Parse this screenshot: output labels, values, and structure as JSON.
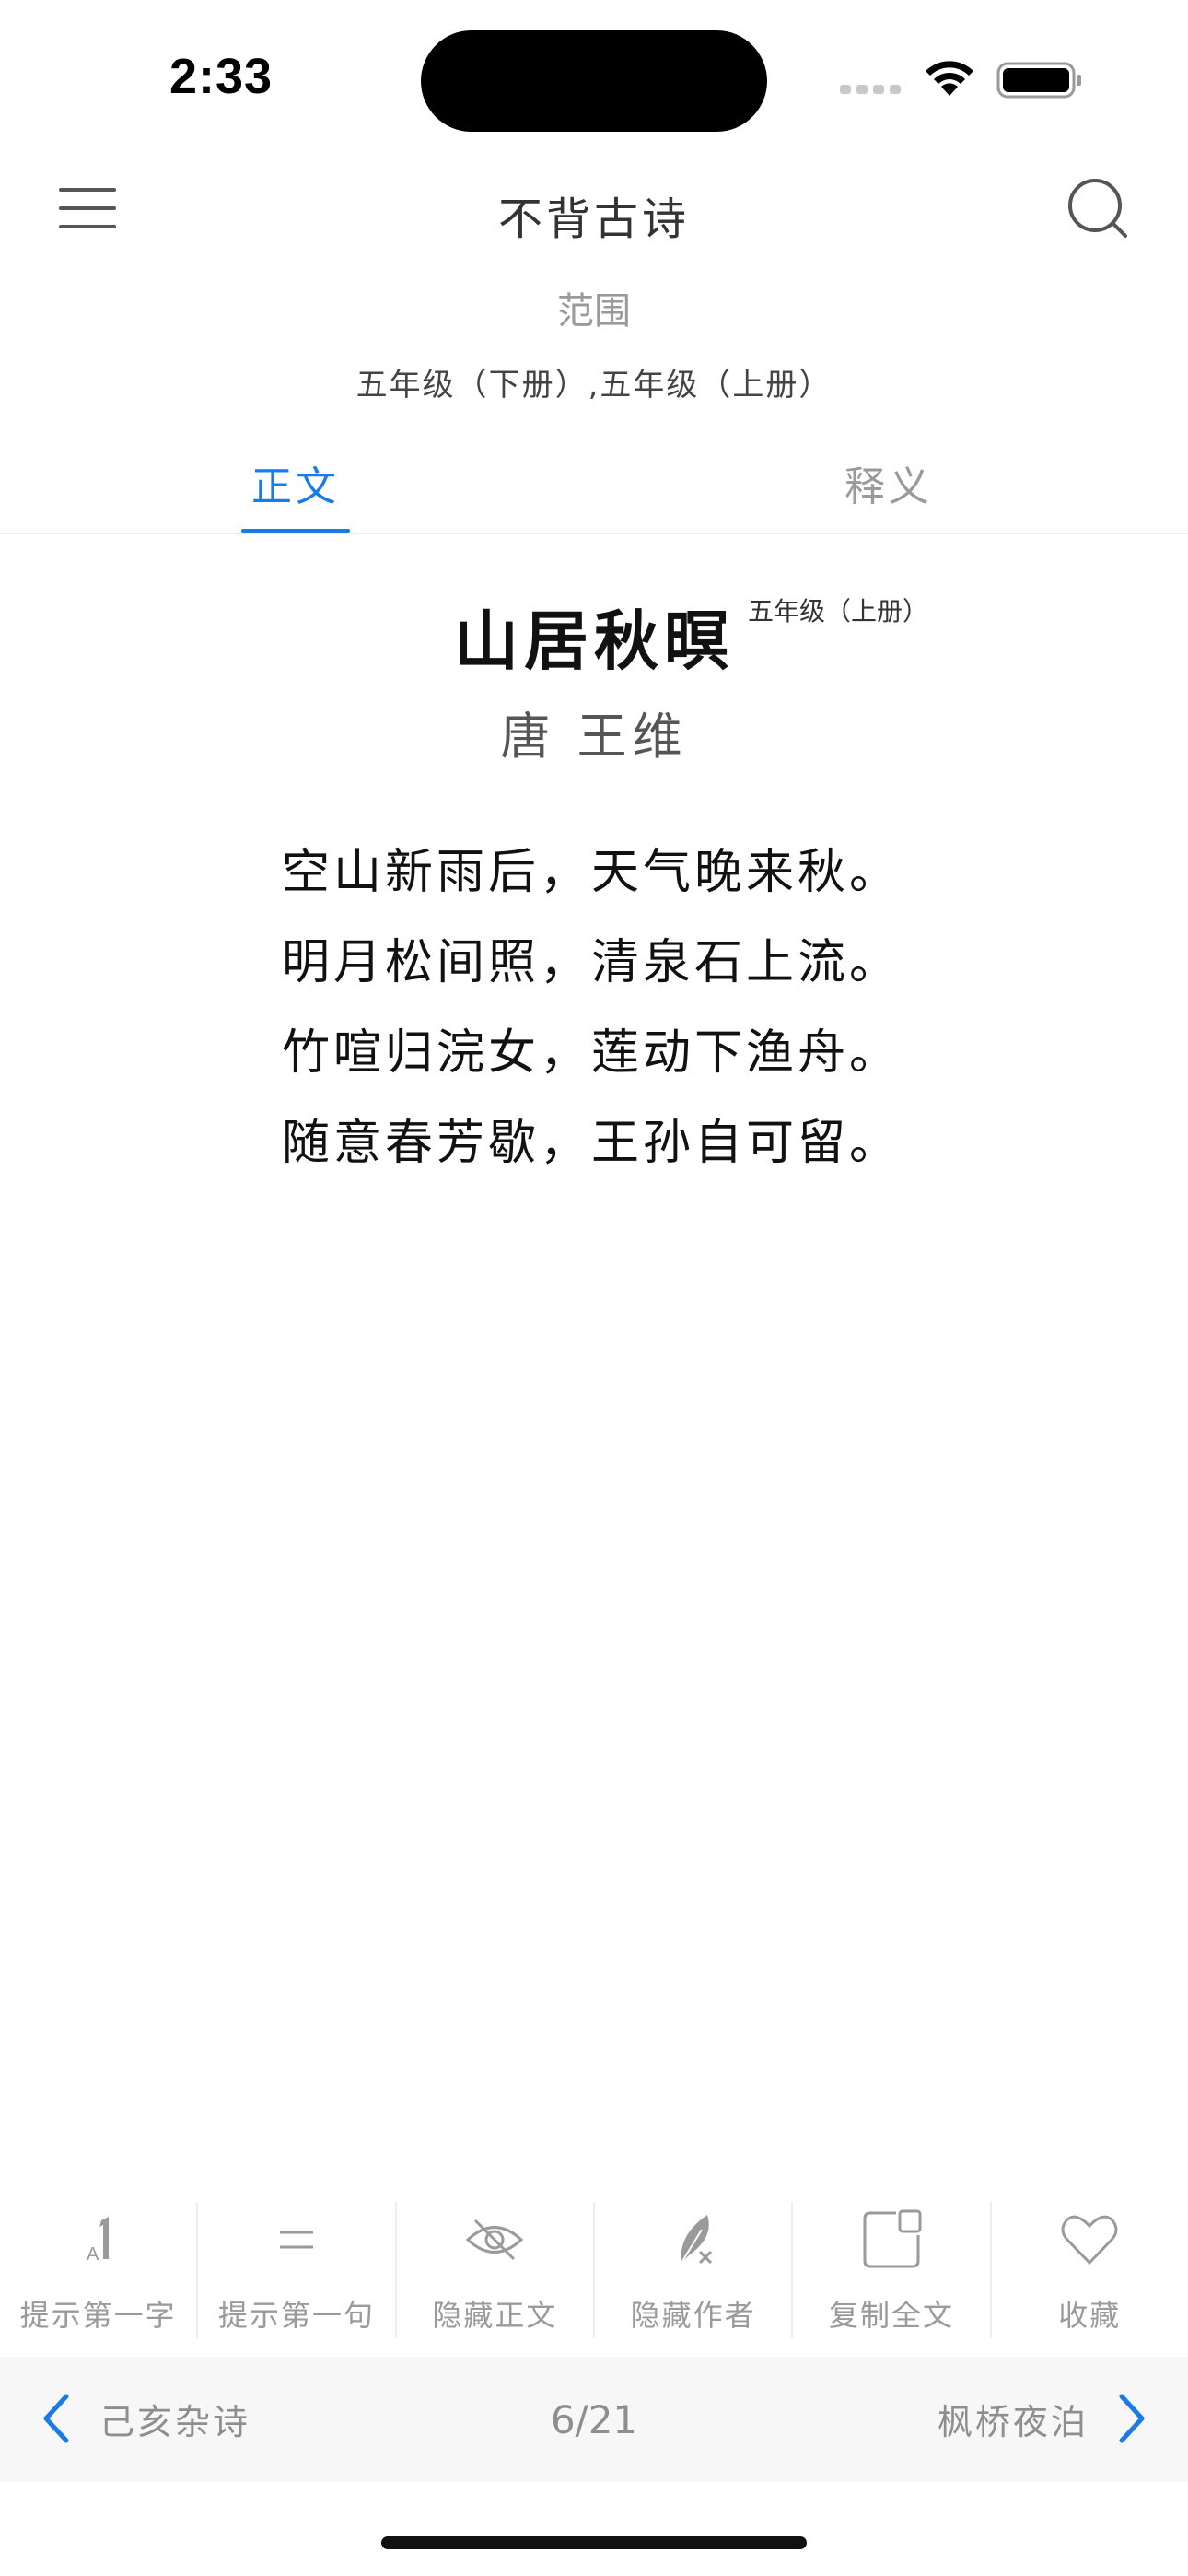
{
  "status_bar": {
    "time": "2:33"
  },
  "header": {
    "title": "不背古诗",
    "menu_icon": "hamburger-menu-icon",
    "search_icon": "search-icon"
  },
  "range": {
    "label": "范围",
    "value": "五年级（下册）,五年级（上册）"
  },
  "tabs": [
    {
      "label": "正文",
      "active": true
    },
    {
      "label": "释义",
      "active": false
    }
  ],
  "poem": {
    "title": "山居秋暝",
    "grade": "五年级（上册）",
    "author": "唐 王维",
    "lines": [
      "空山新雨后，天气晚来秋。",
      "明月松间照，清泉石上流。",
      "竹喧归浣女，莲动下渔舟。",
      "随意春芳歇，王孙自可留。"
    ]
  },
  "toolbar": [
    {
      "label": "提示第一字",
      "icon": "first-char-hint-icon"
    },
    {
      "label": "提示第一句",
      "icon": "first-line-hint-icon"
    },
    {
      "label": "隐藏正文",
      "icon": "hide-eye-icon"
    },
    {
      "label": "隐藏作者",
      "icon": "hide-author-feather-icon"
    },
    {
      "label": "复制全文",
      "icon": "copy-icon"
    },
    {
      "label": "收藏",
      "icon": "heart-icon"
    }
  ],
  "bottom_nav": {
    "prev": "己亥杂诗",
    "counter": "6/21",
    "next": "枫桥夜泊"
  },
  "colors": {
    "accent": "#1a7ae6",
    "muted": "#9a9a9a",
    "nav_bg": "#f7f7f7"
  }
}
